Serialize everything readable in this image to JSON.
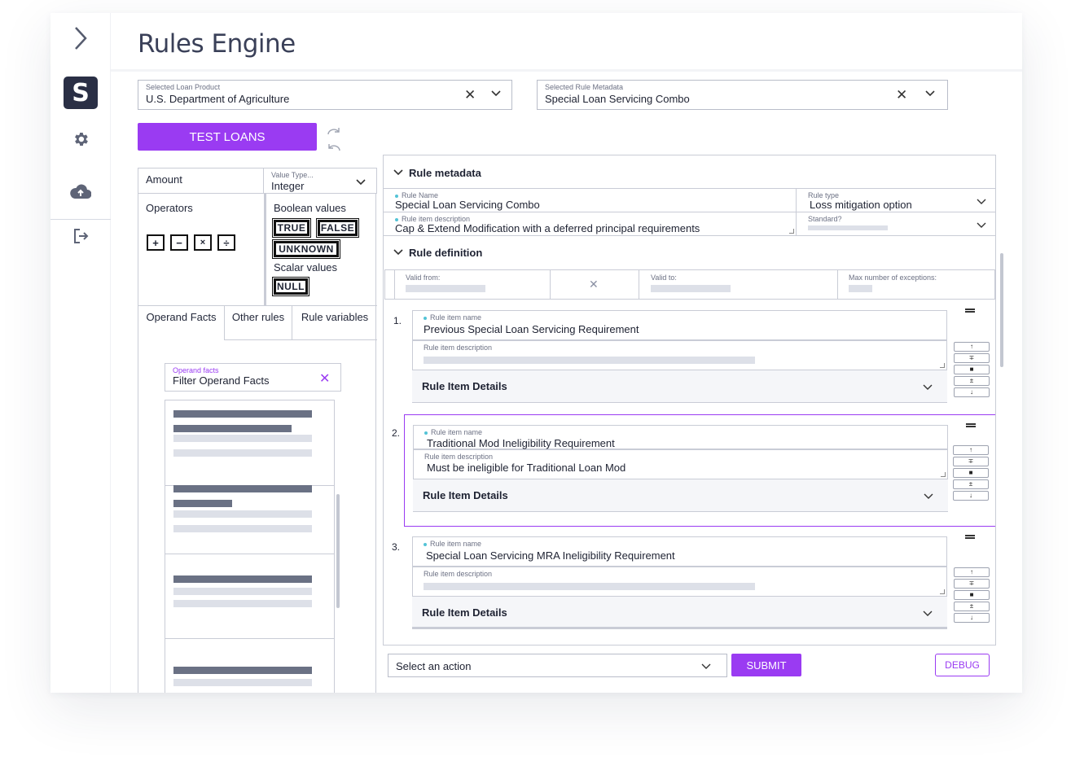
{
  "header": {
    "title": "Rules Engine"
  },
  "selects": {
    "loan_product": {
      "label": "Selected Loan Product",
      "value": "U.S. Department of Agriculture"
    },
    "rule_metadata": {
      "label": "Selected Rule Metadata",
      "value": "Special Loan Servicing Combo"
    }
  },
  "toolbar": {
    "test_loans": "TEST LOANS"
  },
  "left": {
    "amount": "Amount",
    "value_type": {
      "label": "Value Type...",
      "value": "Integer"
    },
    "operators_title": "Operators",
    "operators": [
      "+",
      "−",
      "×",
      "÷"
    ],
    "boolean_title": "Boolean values",
    "boolean_values": [
      "TRUE",
      "FALSE",
      "UNKNOWN"
    ],
    "scalar_title": "Scalar values",
    "scalar_values": [
      "NULL"
    ],
    "tabs": [
      "Operand Facts",
      "Other rules",
      "Rule variables"
    ],
    "filter": {
      "label": "Operand facts",
      "value": "Filter Operand Facts"
    }
  },
  "right": {
    "rule_metadata_title": "Rule metadata",
    "rule_name": {
      "label": "Rule Name",
      "value": "Special Loan Servicing Combo"
    },
    "rule_type": {
      "label": "Rule type",
      "value": "Loss mitigation option"
    },
    "rule_description": {
      "label": "Rule item description",
      "value": "Cap & Extend Modification with a deferred principal requirements"
    },
    "standard": {
      "label": "Standard?"
    },
    "rule_definition_title": "Rule definition",
    "valid_from": "Valid from:",
    "valid_to": "Valid to:",
    "max_exceptions": "Max number of exceptions:",
    "items": [
      {
        "num": "1.",
        "name_label": "Rule item name",
        "name": "Previous Special Loan Servicing Requirement",
        "desc_label": "Rule item description",
        "desc": "",
        "details": "Rule Item Details"
      },
      {
        "num": "2.",
        "name_label": "Rule item name",
        "name": "Traditional Mod Ineligibility Requirement",
        "desc_label": "Rule item description",
        "desc": "Must be ineligible for Traditional Loan Mod",
        "details": "Rule Item Details"
      },
      {
        "num": "3.",
        "name_label": "Rule item name",
        "name": "Special Loan Servicing MRA Ineligibility Requirement",
        "desc_label": "Rule item description",
        "desc": "",
        "details": "Rule Item Details"
      }
    ]
  },
  "footer": {
    "action_placeholder": "Select an action",
    "submit": "SUBMIT",
    "debug": "DEBUG"
  },
  "colors": {
    "accent": "#9a3bf2",
    "navy": "#2a2f45",
    "label_dot": "#53c3d6"
  }
}
